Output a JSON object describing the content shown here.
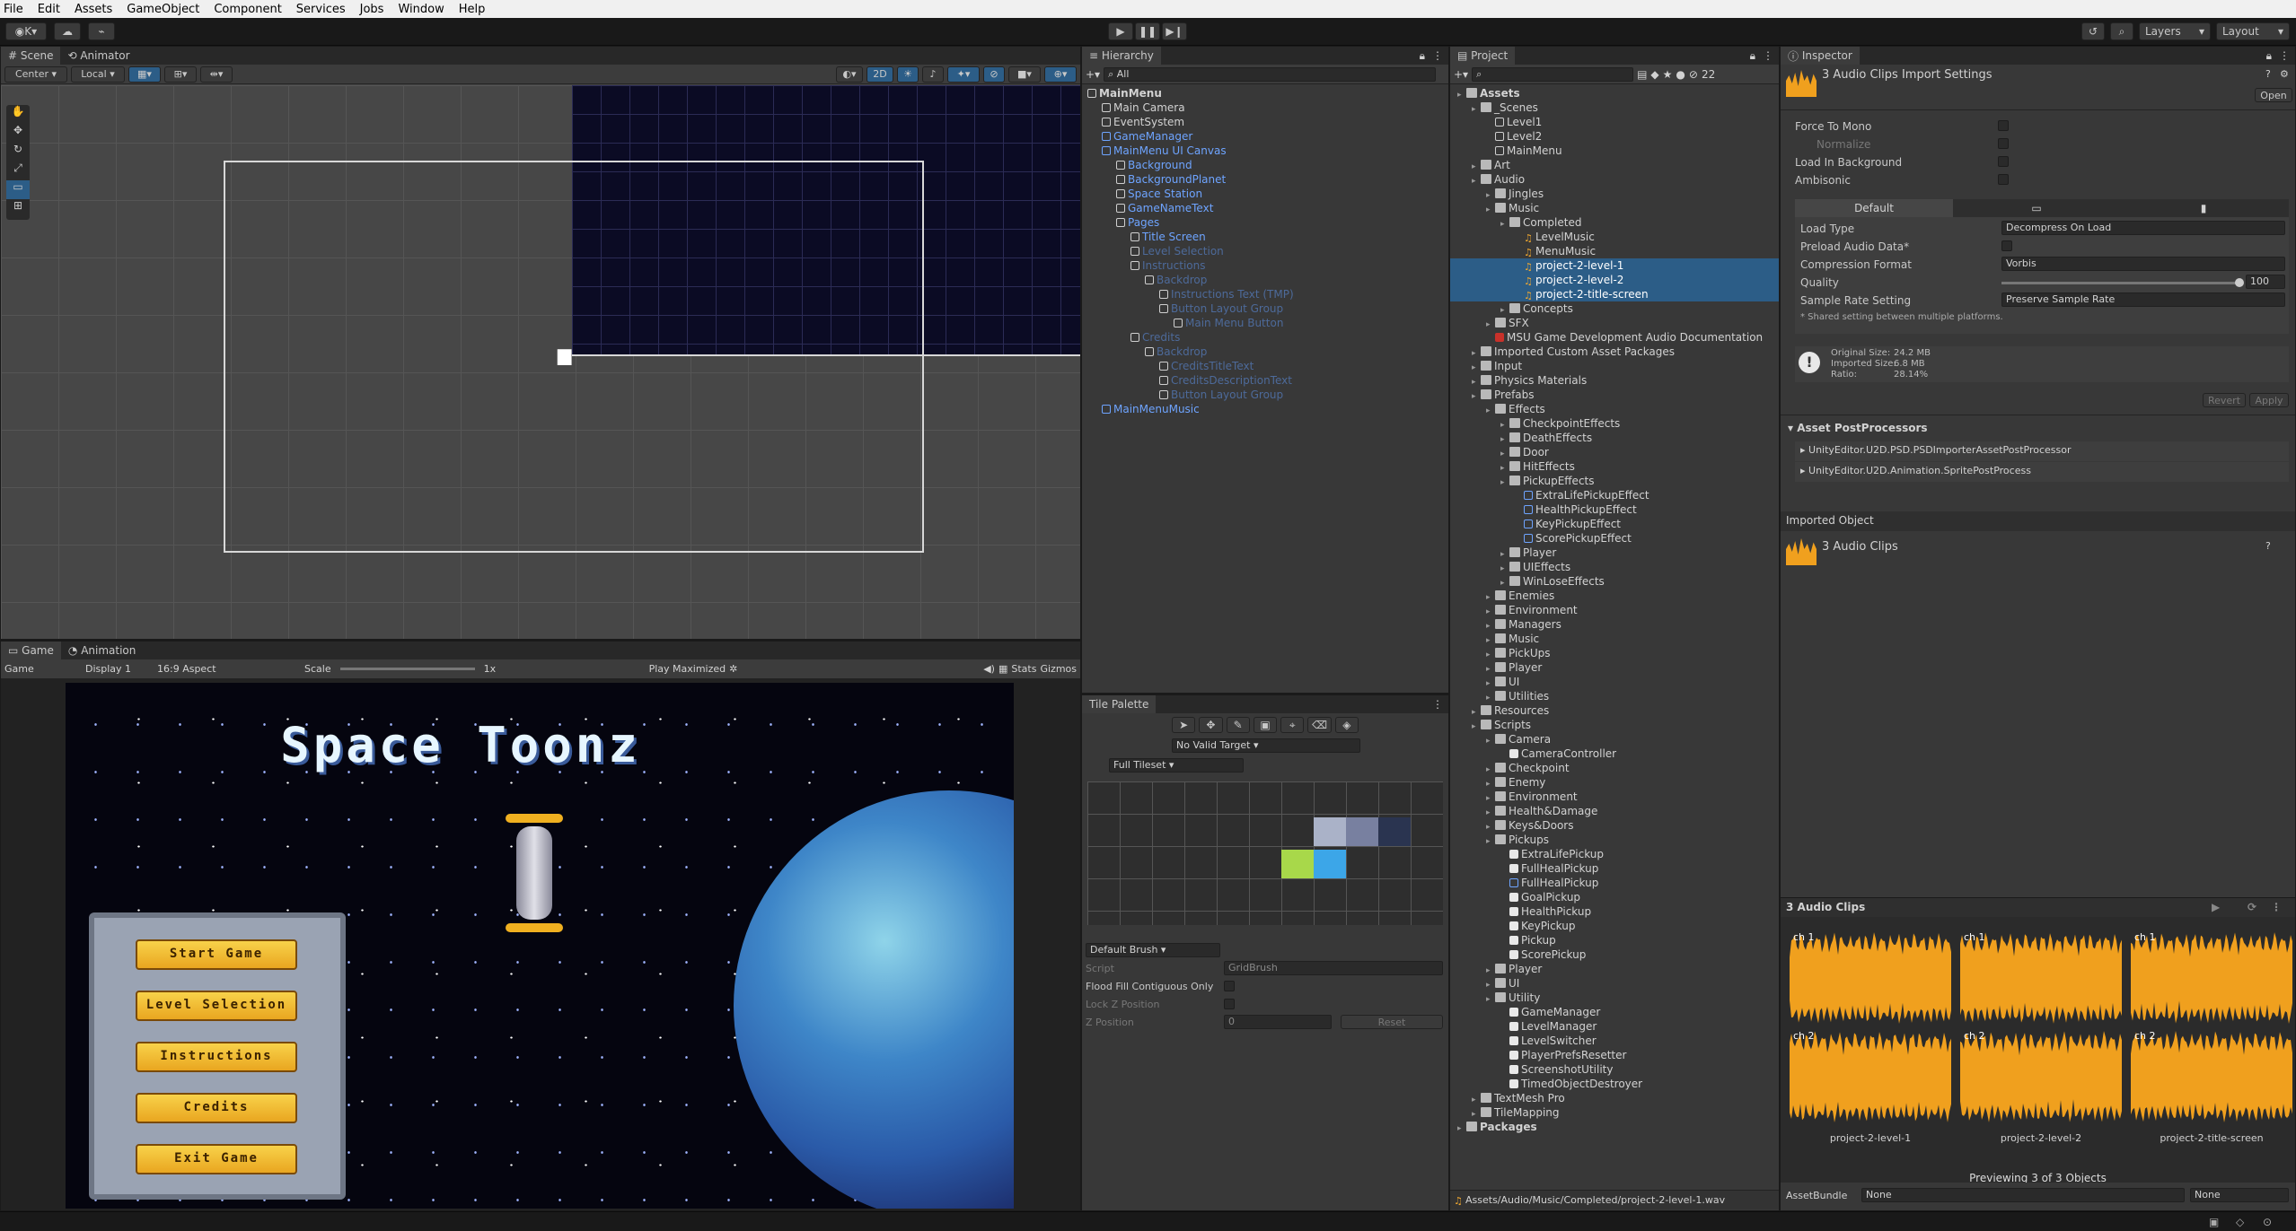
{
  "menubar": {
    "items": [
      "File",
      "Edit",
      "Assets",
      "GameObject",
      "Component",
      "Services",
      "Jobs",
      "Window",
      "Help"
    ]
  },
  "toolbar": {
    "account": "K",
    "layers": "Layers",
    "layout": "Layout"
  },
  "scene": {
    "tabs": [
      "Scene",
      "Animator"
    ],
    "pivot": "Center",
    "space": "Local",
    "mode2d": "2D"
  },
  "game": {
    "tabs": [
      "Game",
      "Animation"
    ],
    "mode": "Game",
    "display": "Display 1",
    "aspect": "16:9 Aspect",
    "scale_label": "Scale",
    "scale_value": "1x",
    "play_mode": "Play Maximized",
    "stats": "Stats",
    "gizmos": "Gizmos",
    "title": "Space Toonz",
    "menu": [
      "Start Game",
      "Level Selection",
      "Instructions",
      "Credits",
      "Exit Game"
    ]
  },
  "hierarchy": {
    "title": "Hierarchy",
    "search": "All",
    "rows": [
      {
        "t": "MainMenu",
        "d": 0,
        "c": "w",
        "i": "scene"
      },
      {
        "t": "Main Camera",
        "d": 1,
        "c": "w",
        "i": "cube"
      },
      {
        "t": "EventSystem",
        "d": 1,
        "c": "w",
        "i": "cube"
      },
      {
        "t": "GameManager",
        "d": 1,
        "c": "b",
        "i": "cubeb"
      },
      {
        "t": "MainMenu UI Canvas",
        "d": 1,
        "c": "b",
        "i": "cubeb"
      },
      {
        "t": "Background",
        "d": 2,
        "c": "b",
        "i": "cube"
      },
      {
        "t": "BackgroundPlanet",
        "d": 2,
        "c": "b",
        "i": "cube"
      },
      {
        "t": "Space Station",
        "d": 2,
        "c": "b",
        "i": "cube"
      },
      {
        "t": "GameNameText",
        "d": 2,
        "c": "b",
        "i": "cube"
      },
      {
        "t": "Pages",
        "d": 2,
        "c": "b",
        "i": "cube"
      },
      {
        "t": "Title Screen",
        "d": 3,
        "c": "b",
        "i": "cube"
      },
      {
        "t": "Level Selection",
        "d": 3,
        "c": "d",
        "i": "cube"
      },
      {
        "t": "Instructions",
        "d": 3,
        "c": "d",
        "i": "cube"
      },
      {
        "t": "Backdrop",
        "d": 4,
        "c": "d",
        "i": "cube"
      },
      {
        "t": "Instructions Text (TMP)",
        "d": 5,
        "c": "d",
        "i": "cube"
      },
      {
        "t": "Button Layout Group",
        "d": 5,
        "c": "d",
        "i": "cube"
      },
      {
        "t": "Main Menu Button",
        "d": 6,
        "c": "d",
        "i": "cube"
      },
      {
        "t": "Credits",
        "d": 3,
        "c": "d",
        "i": "cube"
      },
      {
        "t": "Backdrop",
        "d": 4,
        "c": "d",
        "i": "cube"
      },
      {
        "t": "CreditsTitleText",
        "d": 5,
        "c": "d",
        "i": "cube"
      },
      {
        "t": "CreditsDescriptionText",
        "d": 5,
        "c": "d",
        "i": "cube"
      },
      {
        "t": "Button Layout Group",
        "d": 5,
        "c": "d",
        "i": "cube"
      },
      {
        "t": "MainMenuMusic",
        "d": 1,
        "c": "b",
        "i": "cubeb"
      }
    ]
  },
  "project": {
    "title": "Project",
    "count": "22",
    "path": "Assets/Audio/Music/Completed/project-2-level-1.wav",
    "rows": [
      {
        "t": "Assets",
        "d": 0,
        "i": "fold",
        "b": 1
      },
      {
        "t": "_Scenes",
        "d": 1,
        "i": "fold"
      },
      {
        "t": "Level1",
        "d": 2,
        "i": "scene"
      },
      {
        "t": "Level2",
        "d": 2,
        "i": "scene"
      },
      {
        "t": "MainMenu",
        "d": 2,
        "i": "scene"
      },
      {
        "t": "Art",
        "d": 1,
        "i": "fold"
      },
      {
        "t": "Audio",
        "d": 1,
        "i": "fold"
      },
      {
        "t": "Jingles",
        "d": 2,
        "i": "fold"
      },
      {
        "t": "Music",
        "d": 2,
        "i": "fold"
      },
      {
        "t": "Completed",
        "d": 3,
        "i": "fold"
      },
      {
        "t": "LevelMusic",
        "d": 4,
        "i": "note"
      },
      {
        "t": "MenuMusic",
        "d": 4,
        "i": "note"
      },
      {
        "t": "project-2-level-1",
        "d": 4,
        "i": "note",
        "s": 1
      },
      {
        "t": "project-2-level-2",
        "d": 4,
        "i": "note",
        "s": 1
      },
      {
        "t": "project-2-title-screen",
        "d": 4,
        "i": "note",
        "s": 1
      },
      {
        "t": "Concepts",
        "d": 3,
        "i": "fold"
      },
      {
        "t": "SFX",
        "d": 2,
        "i": "fold"
      },
      {
        "t": "MSU Game Development Audio Documentation",
        "d": 2,
        "i": "pdf"
      },
      {
        "t": "Imported Custom Asset Packages",
        "d": 1,
        "i": "fold"
      },
      {
        "t": "Input",
        "d": 1,
        "i": "fold"
      },
      {
        "t": "Physics Materials",
        "d": 1,
        "i": "fold"
      },
      {
        "t": "Prefabs",
        "d": 1,
        "i": "fold"
      },
      {
        "t": "Effects",
        "d": 2,
        "i": "fold"
      },
      {
        "t": "CheckpointEffects",
        "d": 3,
        "i": "fold"
      },
      {
        "t": "DeathEffects",
        "d": 3,
        "i": "fold"
      },
      {
        "t": "Door",
        "d": 3,
        "i": "fold"
      },
      {
        "t": "HitEffects",
        "d": 3,
        "i": "fold"
      },
      {
        "t": "PickupEffects",
        "d": 3,
        "i": "fold"
      },
      {
        "t": "ExtraLifePickupEffect",
        "d": 4,
        "i": "cubeb"
      },
      {
        "t": "HealthPickupEffect",
        "d": 4,
        "i": "cubeb"
      },
      {
        "t": "KeyPickupEffect",
        "d": 4,
        "i": "cubeb"
      },
      {
        "t": "ScorePickupEffect",
        "d": 4,
        "i": "cubeb"
      },
      {
        "t": "Player",
        "d": 3,
        "i": "fold"
      },
      {
        "t": "UIEffects",
        "d": 3,
        "i": "fold"
      },
      {
        "t": "WinLoseEffects",
        "d": 3,
        "i": "fold"
      },
      {
        "t": "Enemies",
        "d": 2,
        "i": "fold"
      },
      {
        "t": "Environment",
        "d": 2,
        "i": "fold"
      },
      {
        "t": "Managers",
        "d": 2,
        "i": "fold"
      },
      {
        "t": "Music",
        "d": 2,
        "i": "fold"
      },
      {
        "t": "PickUps",
        "d": 2,
        "i": "fold"
      },
      {
        "t": "Player",
        "d": 2,
        "i": "fold"
      },
      {
        "t": "UI",
        "d": 2,
        "i": "fold"
      },
      {
        "t": "Utilities",
        "d": 2,
        "i": "fold"
      },
      {
        "t": "Resources",
        "d": 1,
        "i": "fold"
      },
      {
        "t": "Scripts",
        "d": 1,
        "i": "fold"
      },
      {
        "t": "Camera",
        "d": 2,
        "i": "fold"
      },
      {
        "t": "CameraController",
        "d": 3,
        "i": "file"
      },
      {
        "t": "Checkpoint",
        "d": 2,
        "i": "fold"
      },
      {
        "t": "Enemy",
        "d": 2,
        "i": "fold"
      },
      {
        "t": "Environment",
        "d": 2,
        "i": "fold"
      },
      {
        "t": "Health&Damage",
        "d": 2,
        "i": "fold"
      },
      {
        "t": "Keys&Doors",
        "d": 2,
        "i": "fold"
      },
      {
        "t": "Pickups",
        "d": 2,
        "i": "fold"
      },
      {
        "t": "ExtraLifePickup",
        "d": 3,
        "i": "file"
      },
      {
        "t": "FullHealPickup",
        "d": 3,
        "i": "file"
      },
      {
        "t": "FullHealPickup",
        "d": 3,
        "i": "cubeb"
      },
      {
        "t": "GoalPickup",
        "d": 3,
        "i": "file"
      },
      {
        "t": "HealthPickup",
        "d": 3,
        "i": "file"
      },
      {
        "t": "KeyPickup",
        "d": 3,
        "i": "file"
      },
      {
        "t": "Pickup",
        "d": 3,
        "i": "file"
      },
      {
        "t": "ScorePickup",
        "d": 3,
        "i": "file"
      },
      {
        "t": "Player",
        "d": 2,
        "i": "fold"
      },
      {
        "t": "UI",
        "d": 2,
        "i": "fold"
      },
      {
        "t": "Utility",
        "d": 2,
        "i": "fold"
      },
      {
        "t": "GameManager",
        "d": 3,
        "i": "file"
      },
      {
        "t": "LevelManager",
        "d": 3,
        "i": "file"
      },
      {
        "t": "LevelSwitcher",
        "d": 3,
        "i": "file"
      },
      {
        "t": "PlayerPrefsResetter",
        "d": 3,
        "i": "file"
      },
      {
        "t": "ScreenshotUtility",
        "d": 3,
        "i": "file"
      },
      {
        "t": "TimedObjectDestroyer",
        "d": 3,
        "i": "file"
      },
      {
        "t": "TextMesh Pro",
        "d": 1,
        "i": "fold"
      },
      {
        "t": "TileMapping",
        "d": 1,
        "i": "fold"
      },
      {
        "t": "Packages",
        "d": 0,
        "i": "fold",
        "b": 1
      }
    ]
  },
  "tile": {
    "title": "Tile Palette",
    "target": "No Valid Target",
    "tileset": "Full Tileset",
    "brush": "Default Brush",
    "script_label": "Script",
    "script_value": "GridBrush",
    "flood_label": "Flood Fill Contiguous Only",
    "lockz_label": "Lock Z Position",
    "zpos_label": "Z Position",
    "zpos_value": "0",
    "reset": "Reset"
  },
  "inspector": {
    "title": "Inspector",
    "header": "3 Audio Clips Import Settings",
    "open": "Open",
    "force_mono": "Force To Mono",
    "normalize": "Normalize",
    "load_bg": "Load In Background",
    "ambisonic": "Ambisonic",
    "default_tab": "Default",
    "load_type_label": "Load Type",
    "load_type": "Decompress On Load",
    "preload_label": "Preload Audio Data*",
    "compression_label": "Compression Format",
    "compression": "Vorbis",
    "quality_label": "Quality",
    "quality": "100",
    "sample_label": "Sample Rate Setting",
    "sample": "Preserve Sample Rate",
    "shared_note": "* Shared setting between multiple platforms.",
    "orig_label": "Original Size:",
    "orig": "24.2 MB",
    "imp_label": "Imported Size:",
    "imp": "6.8 MB",
    "ratio_label": "Ratio:",
    "ratio": "28.14%",
    "revert": "Revert",
    "apply": "Apply",
    "postproc_title": "Asset PostProcessors",
    "postproc": [
      "UnityEditor.U2D.PSD.PSDImporterAssetPostProcessor",
      "UnityEditor.U2D.Animation.SpritePostProcess"
    ],
    "imported_object": "Imported Object",
    "imported_name": "3 Audio Clips",
    "preview_title": "3 Audio Clips",
    "clips": [
      {
        "name": "project-2-level-1"
      },
      {
        "name": "project-2-level-2"
      },
      {
        "name": "project-2-title-screen"
      }
    ],
    "ch1": "ch 1",
    "ch2": "ch 2",
    "preview_footer": "Previewing 3 of 3 Objects",
    "assetbundle_label": "AssetBundle",
    "assetbundle": "None",
    "variant": "None"
  },
  "colors": {
    "accent": "#2c5d87",
    "waveform": "#f0a01e",
    "prefab": "#6ea4ff"
  }
}
